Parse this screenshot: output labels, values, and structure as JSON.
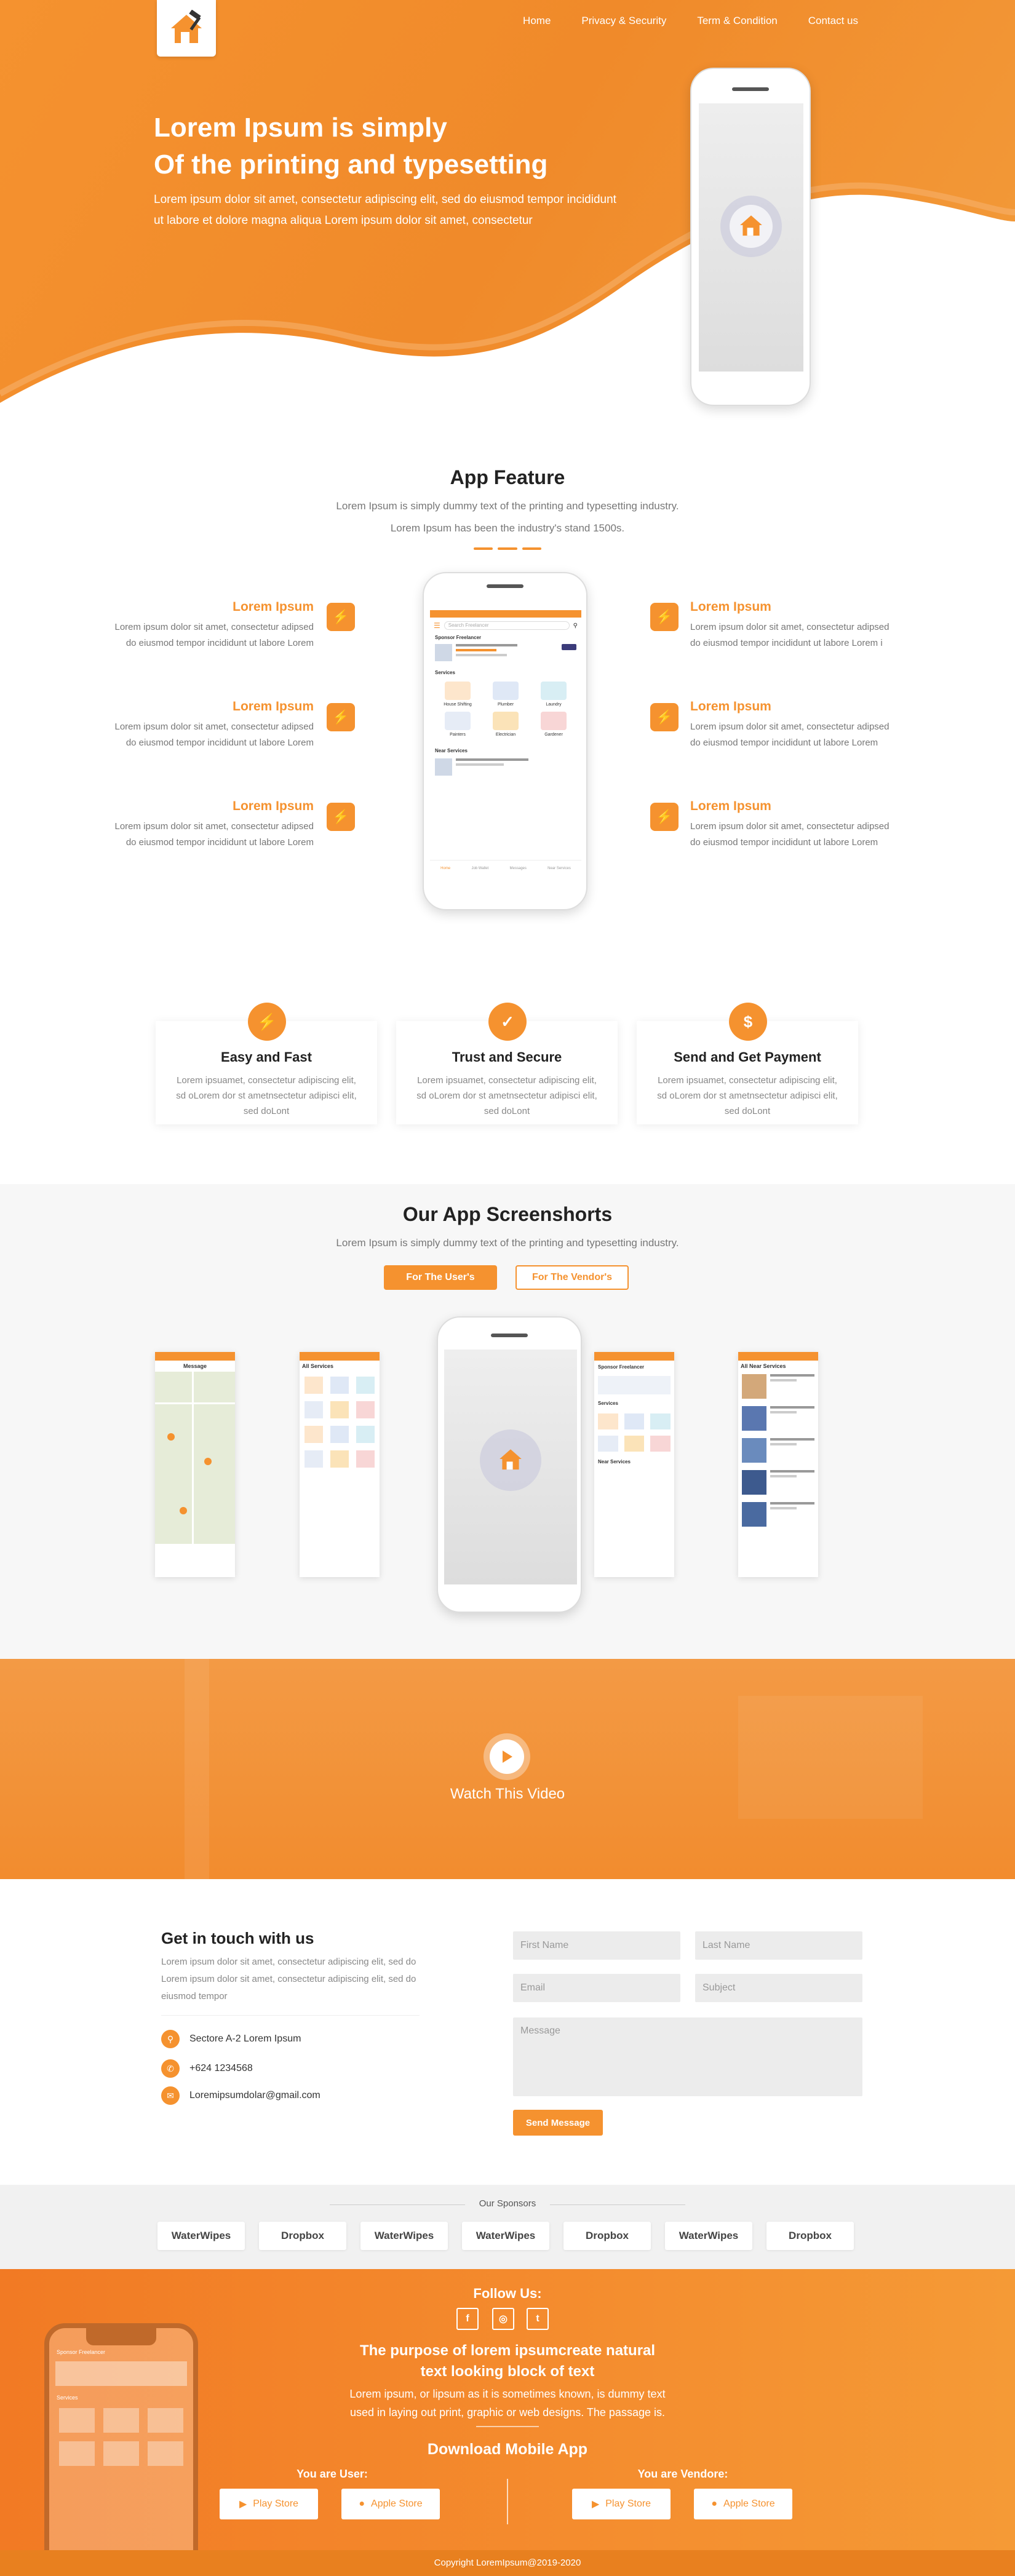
{
  "nav": {
    "items": [
      "Home",
      "Privacy & Security",
      "Term & Condition",
      "Contact us"
    ]
  },
  "hero": {
    "title_line1": "Lorem Ipsum is simply",
    "title_line2": "Of the printing and typesetting",
    "text": "Lorem ipsum dolor sit amet, consectetur adipiscing elit, sed do eiusmod tempor incididunt ut labore et dolore magna aliqua Lorem ipsum dolor sit amet, consectetur"
  },
  "features": {
    "title": "App Feature",
    "subtitle1": "Lorem Ipsum is simply dummy text of the printing and typesetting industry.",
    "subtitle2": "Lorem Ipsum has been the industry's stand 1500s.",
    "items": [
      {
        "title": "Lorem Ipsum",
        "text": "Lorem ipsum dolor sit amet, consectetur adipsed do eiusmod tempor incididunt ut labore Lorem"
      },
      {
        "title": "Lorem Ipsum",
        "text": "Lorem ipsum dolor sit amet, consectetur adipsed do eiusmod tempor incididunt ut labore Lorem"
      },
      {
        "title": "Lorem Ipsum",
        "text": "Lorem ipsum dolor sit amet, consectetur adipsed do eiusmod tempor incididunt ut labore Lorem"
      },
      {
        "title": "Lorem Ipsum",
        "text": "Lorem ipsum dolor sit amet, consectetur adipsed do eiusmod tempor incididunt ut labore Lorem i"
      },
      {
        "title": "Lorem Ipsum",
        "text": "Lorem ipsum dolor sit amet, consectetur adipsed do eiusmod tempor incididunt ut labore Lorem"
      },
      {
        "title": "Lorem Ipsum",
        "text": "Lorem ipsum dolor sit amet, consectetur adipsed do eiusmod tempor incididunt ut labore Lorem"
      }
    ]
  },
  "phone_app": {
    "search_placeholder": "Search Freelancer",
    "sponsor_label": "Sponsor Freelancer",
    "services_label": "Services",
    "services": [
      "House Shifting",
      "Plumber",
      "Laundry",
      "Painters",
      "Electrician",
      "Gardener"
    ],
    "near_label": "Near Services",
    "tabs": [
      "Home",
      "Job Wallet",
      "Messages",
      "Near Services"
    ]
  },
  "benefits": [
    {
      "icon": "⚡",
      "title": "Easy and Fast",
      "text": "Lorem ipsuamet, consectetur adipiscing elit, sd oLorem dor st ametnsectetur adipisci elit, sed doLont"
    },
    {
      "icon": "✓",
      "title": "Trust and Secure",
      "text": "Lorem ipsuamet, consectetur adipiscing elit, sd oLorem dor st ametnsectetur adipisci elit, sed doLont"
    },
    {
      "icon": "$",
      "title": "Send and Get Payment",
      "text": "Lorem ipsuamet, consectetur adipiscing elit, sd oLorem dor st ametnsectetur adipisci elit, sed doLont"
    }
  ],
  "screens": {
    "title": "Our App Screenshorts",
    "subtitle": "Lorem Ipsum is simply dummy text of the printing and typesetting industry.",
    "btn_users": "For The User's",
    "btn_vendors": "For The Vendor's",
    "message_label": "Message",
    "all_services_label": "All Services",
    "all_near_label": "All Near Services"
  },
  "video": {
    "label": "Watch This Video"
  },
  "contact": {
    "title": "Get in touch with us",
    "text": "Lorem ipsum dolor sit amet, consectetur adipiscing elit, sed do Lorem ipsum dolor sit amet, consectetur adipiscing elit, sed do eiusmod tempor",
    "address": "Sectore A-2 Lorem Ipsum",
    "phone": "+624 1234568",
    "email": "Loremipsumdolar@gmail.com",
    "first_name": "First Name",
    "last_name": "Last Name",
    "email_ph": "Email",
    "subject_ph": "Subject",
    "message_ph": "Message",
    "send": "Send Message"
  },
  "sponsors": {
    "label": "Our Sponsors",
    "items": [
      "WaterWipes",
      "Dropbox",
      "WaterWipes",
      "WaterWipes",
      "Dropbox",
      "WaterWipes",
      "Dropbox"
    ]
  },
  "footer": {
    "follow": "Follow Us:",
    "social": [
      "f",
      "◎",
      "t"
    ],
    "purpose1": "The purpose of lorem ipsumcreate natural",
    "purpose2": "text looking block of text",
    "desc1": "Lorem ipsum, or lipsum as it is sometimes known, is dummy text",
    "desc2": "used in laying out print, graphic or web designs. The passage is.",
    "download": "Download Mobile App",
    "user_label": "You are User:",
    "vendor_label": "You are Vendore:",
    "play": "Play Store",
    "apple": "Apple Store",
    "copyright": "Copyright LoremIpsum@2019-2020"
  },
  "colors": {
    "accent": "#f5922f",
    "dark_accent": "#e8801f"
  }
}
